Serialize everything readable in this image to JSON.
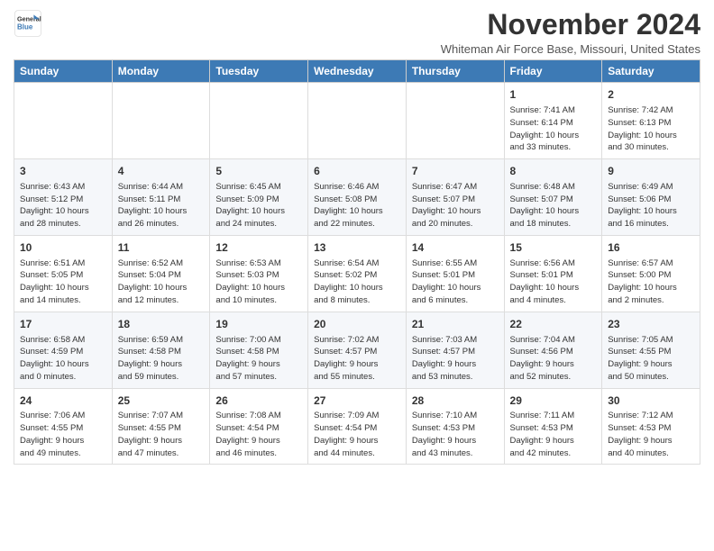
{
  "header": {
    "logo_line1": "General",
    "logo_line2": "Blue",
    "month_title": "November 2024",
    "location": "Whiteman Air Force Base, Missouri, United States"
  },
  "weekdays": [
    "Sunday",
    "Monday",
    "Tuesday",
    "Wednesday",
    "Thursday",
    "Friday",
    "Saturday"
  ],
  "weeks": [
    [
      {
        "day": "",
        "info": ""
      },
      {
        "day": "",
        "info": ""
      },
      {
        "day": "",
        "info": ""
      },
      {
        "day": "",
        "info": ""
      },
      {
        "day": "",
        "info": ""
      },
      {
        "day": "1",
        "info": "Sunrise: 7:41 AM\nSunset: 6:14 PM\nDaylight: 10 hours\nand 33 minutes."
      },
      {
        "day": "2",
        "info": "Sunrise: 7:42 AM\nSunset: 6:13 PM\nDaylight: 10 hours\nand 30 minutes."
      }
    ],
    [
      {
        "day": "3",
        "info": "Sunrise: 6:43 AM\nSunset: 5:12 PM\nDaylight: 10 hours\nand 28 minutes."
      },
      {
        "day": "4",
        "info": "Sunrise: 6:44 AM\nSunset: 5:11 PM\nDaylight: 10 hours\nand 26 minutes."
      },
      {
        "day": "5",
        "info": "Sunrise: 6:45 AM\nSunset: 5:09 PM\nDaylight: 10 hours\nand 24 minutes."
      },
      {
        "day": "6",
        "info": "Sunrise: 6:46 AM\nSunset: 5:08 PM\nDaylight: 10 hours\nand 22 minutes."
      },
      {
        "day": "7",
        "info": "Sunrise: 6:47 AM\nSunset: 5:07 PM\nDaylight: 10 hours\nand 20 minutes."
      },
      {
        "day": "8",
        "info": "Sunrise: 6:48 AM\nSunset: 5:07 PM\nDaylight: 10 hours\nand 18 minutes."
      },
      {
        "day": "9",
        "info": "Sunrise: 6:49 AM\nSunset: 5:06 PM\nDaylight: 10 hours\nand 16 minutes."
      }
    ],
    [
      {
        "day": "10",
        "info": "Sunrise: 6:51 AM\nSunset: 5:05 PM\nDaylight: 10 hours\nand 14 minutes."
      },
      {
        "day": "11",
        "info": "Sunrise: 6:52 AM\nSunset: 5:04 PM\nDaylight: 10 hours\nand 12 minutes."
      },
      {
        "day": "12",
        "info": "Sunrise: 6:53 AM\nSunset: 5:03 PM\nDaylight: 10 hours\nand 10 minutes."
      },
      {
        "day": "13",
        "info": "Sunrise: 6:54 AM\nSunset: 5:02 PM\nDaylight: 10 hours\nand 8 minutes."
      },
      {
        "day": "14",
        "info": "Sunrise: 6:55 AM\nSunset: 5:01 PM\nDaylight: 10 hours\nand 6 minutes."
      },
      {
        "day": "15",
        "info": "Sunrise: 6:56 AM\nSunset: 5:01 PM\nDaylight: 10 hours\nand 4 minutes."
      },
      {
        "day": "16",
        "info": "Sunrise: 6:57 AM\nSunset: 5:00 PM\nDaylight: 10 hours\nand 2 minutes."
      }
    ],
    [
      {
        "day": "17",
        "info": "Sunrise: 6:58 AM\nSunset: 4:59 PM\nDaylight: 10 hours\nand 0 minutes."
      },
      {
        "day": "18",
        "info": "Sunrise: 6:59 AM\nSunset: 4:58 PM\nDaylight: 9 hours\nand 59 minutes."
      },
      {
        "day": "19",
        "info": "Sunrise: 7:00 AM\nSunset: 4:58 PM\nDaylight: 9 hours\nand 57 minutes."
      },
      {
        "day": "20",
        "info": "Sunrise: 7:02 AM\nSunset: 4:57 PM\nDaylight: 9 hours\nand 55 minutes."
      },
      {
        "day": "21",
        "info": "Sunrise: 7:03 AM\nSunset: 4:57 PM\nDaylight: 9 hours\nand 53 minutes."
      },
      {
        "day": "22",
        "info": "Sunrise: 7:04 AM\nSunset: 4:56 PM\nDaylight: 9 hours\nand 52 minutes."
      },
      {
        "day": "23",
        "info": "Sunrise: 7:05 AM\nSunset: 4:55 PM\nDaylight: 9 hours\nand 50 minutes."
      }
    ],
    [
      {
        "day": "24",
        "info": "Sunrise: 7:06 AM\nSunset: 4:55 PM\nDaylight: 9 hours\nand 49 minutes."
      },
      {
        "day": "25",
        "info": "Sunrise: 7:07 AM\nSunset: 4:55 PM\nDaylight: 9 hours\nand 47 minutes."
      },
      {
        "day": "26",
        "info": "Sunrise: 7:08 AM\nSunset: 4:54 PM\nDaylight: 9 hours\nand 46 minutes."
      },
      {
        "day": "27",
        "info": "Sunrise: 7:09 AM\nSunset: 4:54 PM\nDaylight: 9 hours\nand 44 minutes."
      },
      {
        "day": "28",
        "info": "Sunrise: 7:10 AM\nSunset: 4:53 PM\nDaylight: 9 hours\nand 43 minutes."
      },
      {
        "day": "29",
        "info": "Sunrise: 7:11 AM\nSunset: 4:53 PM\nDaylight: 9 hours\nand 42 minutes."
      },
      {
        "day": "30",
        "info": "Sunrise: 7:12 AM\nSunset: 4:53 PM\nDaylight: 9 hours\nand 40 minutes."
      }
    ]
  ]
}
